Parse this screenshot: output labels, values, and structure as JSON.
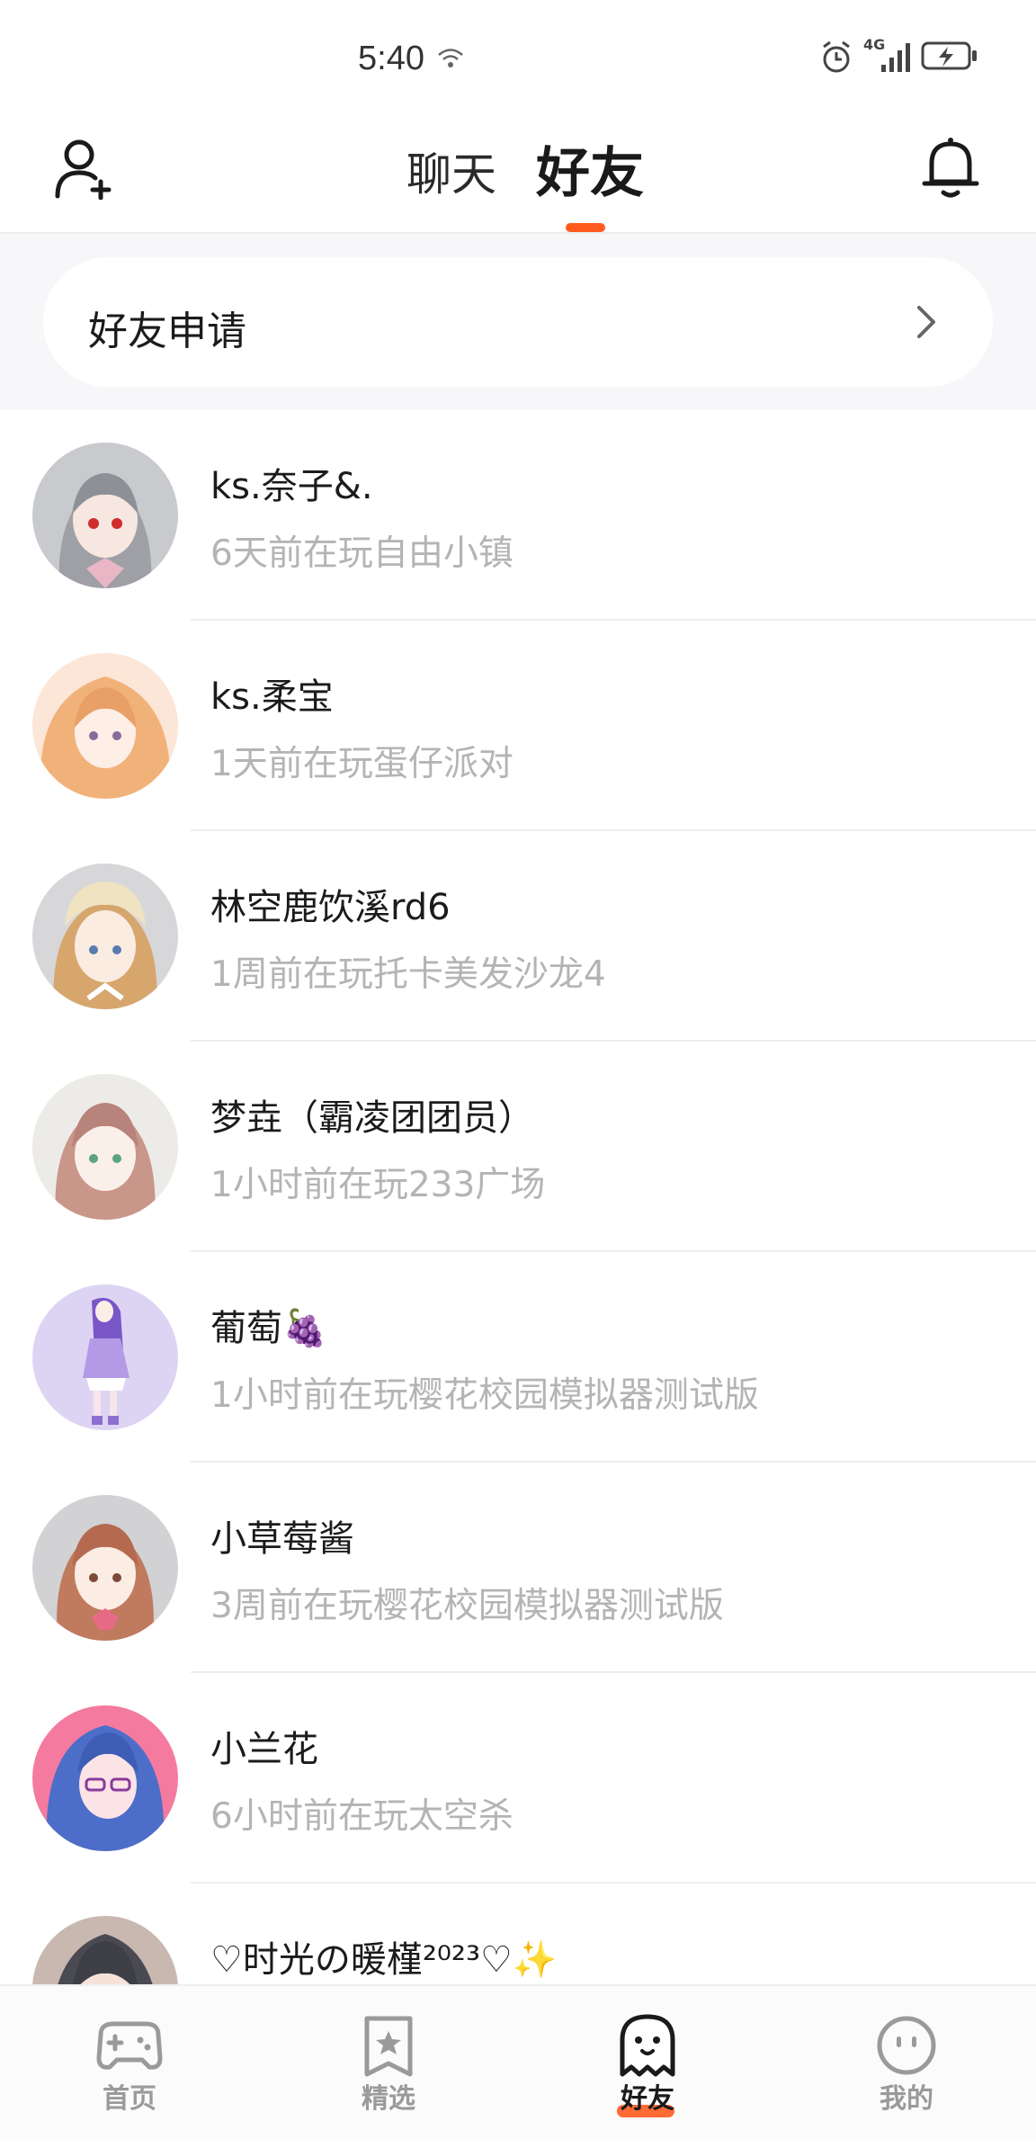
{
  "status_bar": {
    "time": "5:40",
    "network": "4G"
  },
  "header": {
    "tabs": [
      {
        "label": "聊天",
        "active": false
      },
      {
        "label": "好友",
        "active": true
      }
    ],
    "accent_color": "#ff5a1f"
  },
  "friend_request": {
    "label": "好友申请"
  },
  "friends": [
    {
      "name": "ks.奈子&.",
      "status": "6天前在玩自由小镇",
      "avatar": "anime-girl-silver-hair"
    },
    {
      "name": "ks.柔宝",
      "status": "1天前在玩蛋仔派对",
      "avatar": "anime-girl-peach-hair"
    },
    {
      "name": "林空鹿饮溪rd6",
      "status": "1周前在玩托卡美发沙龙4",
      "avatar": "anime-girl-blonde-bonnet"
    },
    {
      "name": "梦垚（霸凌团团员）",
      "status": "1小时前在玩233广场",
      "avatar": "anime-girl-pink-braids"
    },
    {
      "name": "葡萄🍇",
      "status": "1小时前在玩樱花校园模拟器测试版",
      "avatar": "anime-girl-purple-dress"
    },
    {
      "name": "小草莓酱",
      "status": "3周前在玩樱花校园模拟器测试版",
      "avatar": "anime-girl-strawberry"
    },
    {
      "name": "小兰花",
      "status": "6小时前在玩太空杀",
      "avatar": "anime-girl-blue-hair-pink-bg"
    },
    {
      "name": "♡时光の暖槿²⁰²³♡✨",
      "status": "",
      "avatar": "anime-girl-dark-hair"
    }
  ],
  "bottom_nav": [
    {
      "label": "首页",
      "icon": "gamepad-icon",
      "active": false
    },
    {
      "label": "精选",
      "icon": "star-bookmark-icon",
      "active": false
    },
    {
      "label": "好友",
      "icon": "ghost-icon",
      "active": true
    },
    {
      "label": "我的",
      "icon": "smiley-face-icon",
      "active": false
    }
  ]
}
